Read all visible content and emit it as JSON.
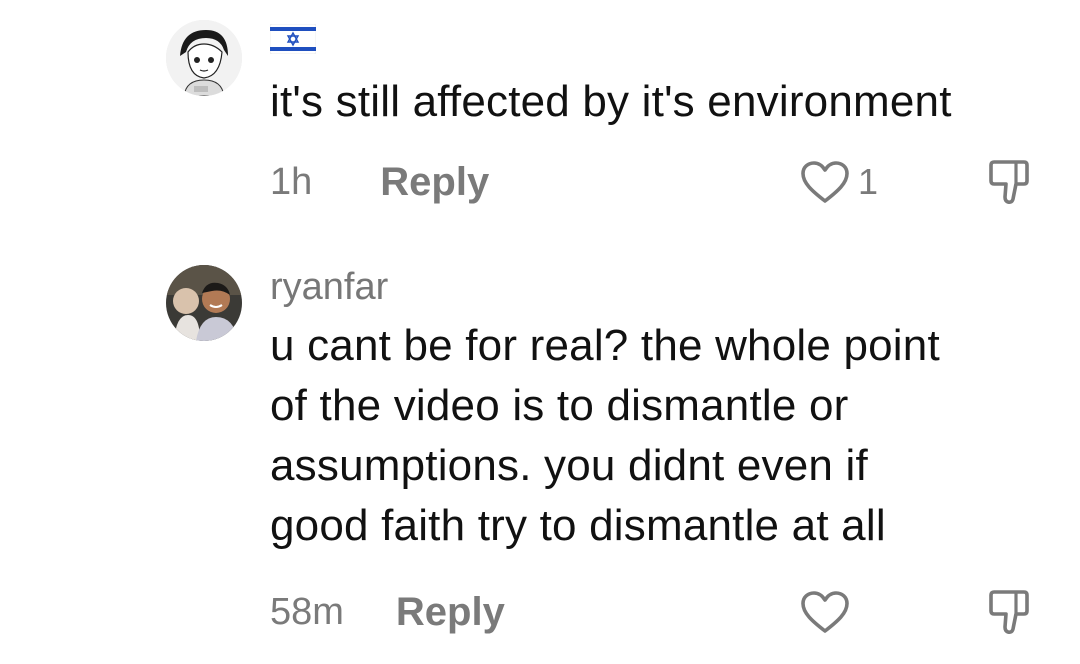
{
  "comments": [
    {
      "username": "",
      "flag": "israel-flag-icon",
      "text": "it's still affected by it's environment",
      "timestamp": "1h",
      "reply_label": "Reply",
      "like_count": "1"
    },
    {
      "username": "ryanfar",
      "text_lines": [
        "u cant be for real? the whole point",
        "of the video is to dismantle or",
        "assumptions. you didnt even if",
        "good faith try to dismantle at all"
      ],
      "timestamp": "58m",
      "reply_label": "Reply",
      "like_count": ""
    }
  ],
  "colors": {
    "text": "#111111",
    "muted": "#7a7a7a",
    "flag_blue": "#1f4fbf"
  }
}
